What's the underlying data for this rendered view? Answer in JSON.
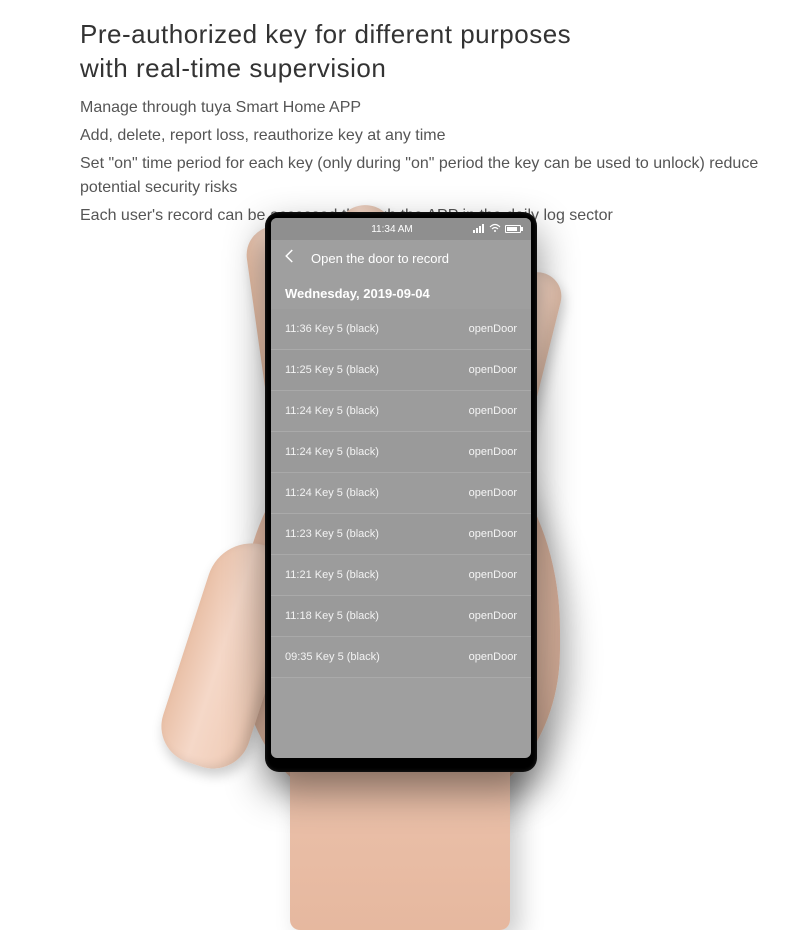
{
  "heading_line1": "Pre-authorized key for different purposes",
  "heading_line2": "with real-time supervision",
  "sub1": "Manage through tuya Smart Home APP",
  "sub2": "Add, delete, report loss, reauthorize key at any time",
  "sub3": "Set \"on\" time period for each key (only during \"on\" period the key can be used to unlock) reduce potential security risks",
  "sub4": "Each user's record can be accessed through the APP in the daily log sector",
  "phone": {
    "status_time": "11:34 AM",
    "app_title": "Open the door to record",
    "date_header": "Wednesday, 2019-09-04",
    "logs": [
      {
        "time": "11:36",
        "desc": "Key 5 (black)",
        "action": "openDoor"
      },
      {
        "time": "11:25",
        "desc": "Key 5 (black)",
        "action": "openDoor"
      },
      {
        "time": "11:24",
        "desc": "Key 5 (black)",
        "action": "openDoor"
      },
      {
        "time": "11:24",
        "desc": "Key 5 (black)",
        "action": "openDoor"
      },
      {
        "time": "11:24",
        "desc": "Key 5 (black)",
        "action": "openDoor"
      },
      {
        "time": "11:23",
        "desc": "Key 5 (black)",
        "action": "openDoor"
      },
      {
        "time": "11:21",
        "desc": "Key 5 (black)",
        "action": "openDoor"
      },
      {
        "time": "11:18",
        "desc": "Key 5 (black)",
        "action": "openDoor"
      },
      {
        "time": "09:35",
        "desc": "Key 5 (black)",
        "action": "openDoor"
      }
    ]
  }
}
